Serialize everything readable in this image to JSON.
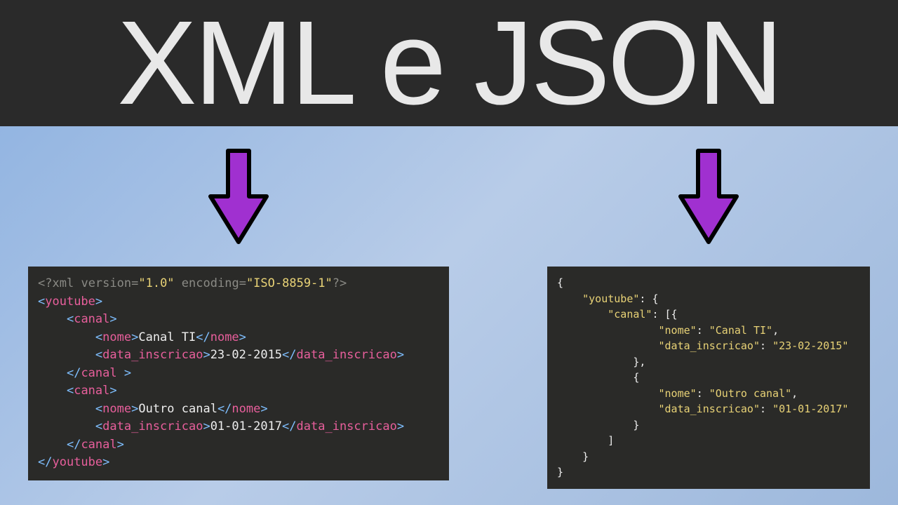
{
  "title": "XML e JSON",
  "xml": {
    "decl_open": "<?",
    "decl_name": "xml",
    "decl_attr_version_name": "version",
    "decl_attr_version_val": "\"1.0\"",
    "decl_attr_encoding_name": "encoding",
    "decl_attr_encoding_val": "\"ISO-8859-1\"",
    "decl_close": "?>",
    "root_tag": "youtube",
    "canal_tag": "canal",
    "nome_tag": "nome",
    "data_tag": "data_inscricao",
    "canals": [
      {
        "nome": "Canal TI",
        "data": "23-02-2015"
      },
      {
        "nome": "Outro canal",
        "data": "01-01-2017"
      }
    ]
  },
  "json": {
    "key_youtube": "\"youtube\"",
    "key_canal": "\"canal\"",
    "key_nome": "\"nome\"",
    "key_data": "\"data_inscricao\"",
    "entries": [
      {
        "nome": "\"Canal TI\"",
        "data": "\"23-02-2015\""
      },
      {
        "nome": "\"Outro canal\"",
        "data": "\"01-01-2017\""
      }
    ]
  }
}
